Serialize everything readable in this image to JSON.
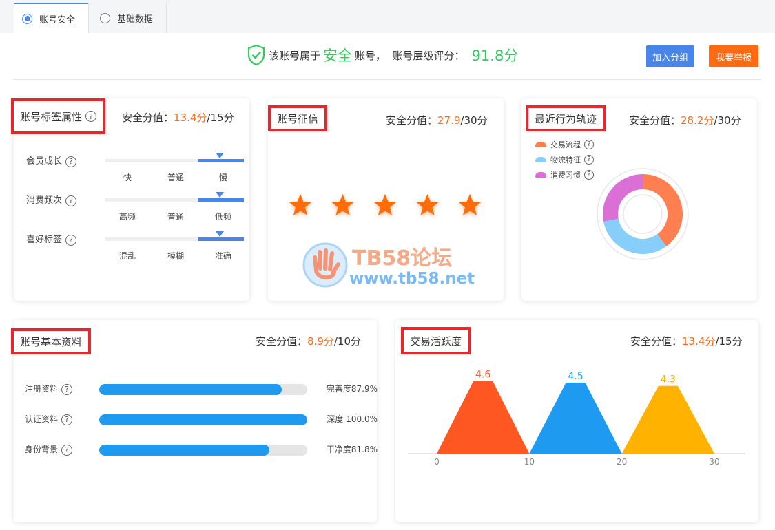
{
  "tabs": [
    {
      "label": "账号安全",
      "selected": true
    },
    {
      "label": "基础数据",
      "selected": false
    }
  ],
  "summary": {
    "prefix": "该账号属于",
    "level": "安全",
    "mid": "账号，  账号层级评分：",
    "score": "91.8分"
  },
  "buttons": {
    "join_group": "加入分组",
    "report": "我要举报"
  },
  "help_glyph": "?",
  "cards": {
    "tags": {
      "title": "账号标签属性",
      "score_label": "安全分值：",
      "score": "13.4分",
      "total": "/15分",
      "rows": [
        {
          "label": "会员成长",
          "values": [
            "快",
            "普通",
            "慢"
          ]
        },
        {
          "label": "消费频次",
          "values": [
            "高频",
            "普通",
            "低频"
          ]
        },
        {
          "label": "喜好标签",
          "values": [
            "混乱",
            "模糊",
            "准确"
          ]
        }
      ]
    },
    "credit": {
      "title": "账号征信",
      "score_label": "安全分值：",
      "score": "27.9",
      "total": "/30分",
      "stars": 5
    },
    "behavior": {
      "title": "最近行为轨迹",
      "score_label": "安全分值：",
      "score": "28.2分",
      "total": "/30分",
      "legend": [
        {
          "label": "交易流程",
          "color": "#ff7f50"
        },
        {
          "label": "物流特征",
          "color": "#87cefa"
        },
        {
          "label": "消费习惯",
          "color": "#da70d6"
        }
      ]
    },
    "basic": {
      "title": "账号基本资料",
      "score_label": "安全分值：",
      "score": "8.9分",
      "total": "/10分",
      "rows": [
        {
          "label": "注册资料",
          "value": "完善度87.9%",
          "fill": 0.879
        },
        {
          "label": "认证资料",
          "value": "深度 100.0%",
          "fill": 1.0
        },
        {
          "label": "身份背景",
          "value": "干净度81.8%",
          "fill": 0.818
        }
      ]
    },
    "activity": {
      "title": "交易活跃度",
      "score_label": "安全分值：",
      "score": "13.4分",
      "total": "/15分"
    }
  },
  "watermark": {
    "title": "TB58论坛",
    "url": "www.tb58.net"
  },
  "chart_data": [
    {
      "type": "pie",
      "categories": [
        "交易流程",
        "物流特征",
        "消费习惯"
      ],
      "values": [
        40,
        32,
        28
      ],
      "colors": [
        "#ff7f50",
        "#87cefa",
        "#da70d6"
      ],
      "legend": "top-left"
    },
    {
      "type": "area",
      "x_ticks": [
        0,
        10,
        20,
        30
      ],
      "xlim": [
        0,
        30
      ],
      "series": [
        {
          "x": [
            0,
            5,
            10
          ],
          "values": [
            0,
            4.6,
            0
          ],
          "label": "4.6",
          "color": "#ff5722"
        },
        {
          "x": [
            10,
            15,
            20
          ],
          "values": [
            0,
            4.5,
            0
          ],
          "label": "4.5",
          "color": "#1e9bf0"
        },
        {
          "x": [
            20,
            25,
            30
          ],
          "values": [
            0,
            4.3,
            0
          ],
          "label": "4.3",
          "color": "#ffb300"
        }
      ]
    }
  ]
}
